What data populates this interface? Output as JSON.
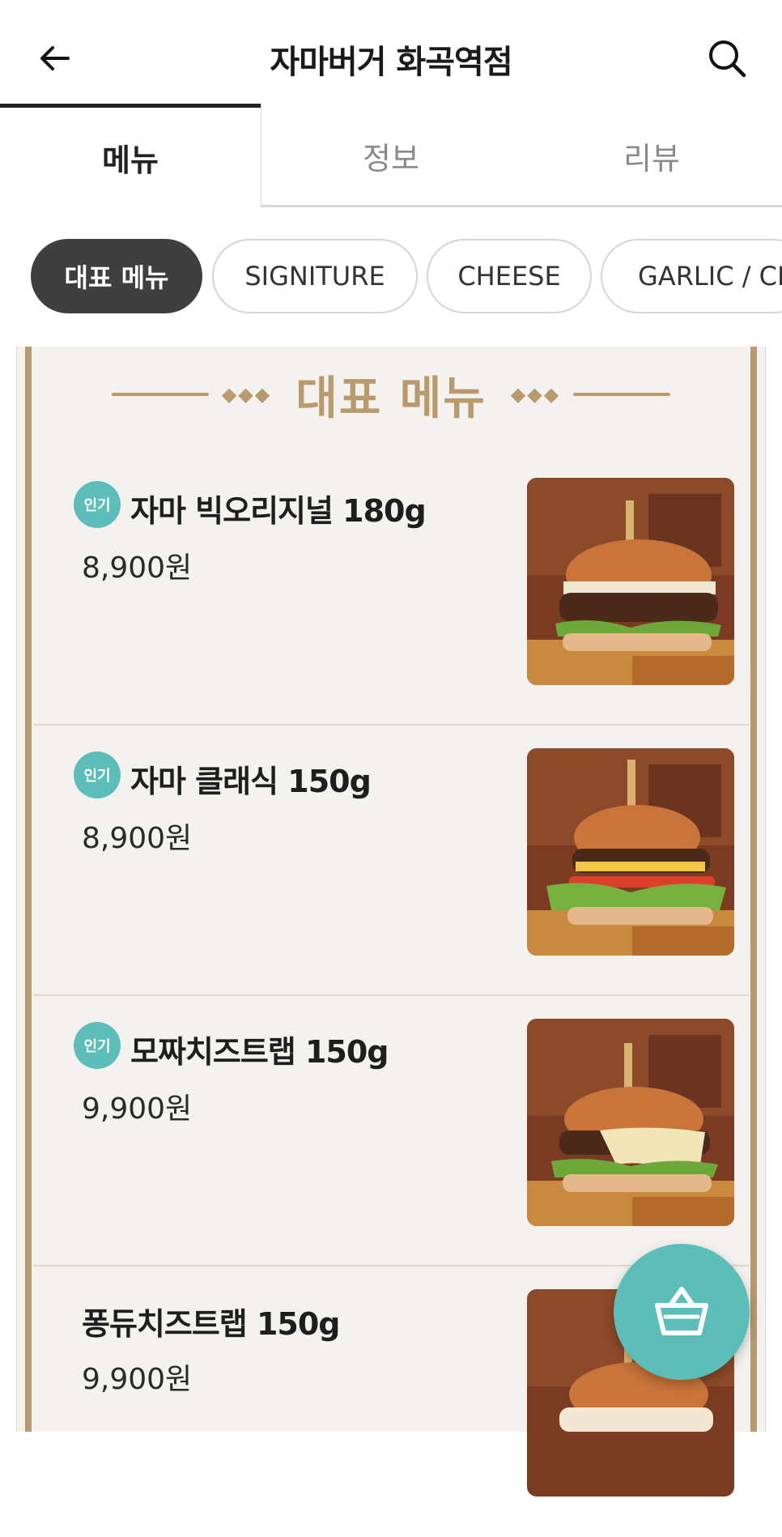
{
  "header": {
    "title": "자마버거 화곡역점",
    "back_icon": "back-arrow-icon",
    "search_icon": "search-icon"
  },
  "tabs": [
    {
      "label": "메뉴",
      "active": true
    },
    {
      "label": "정보",
      "active": false
    },
    {
      "label": "리뷰",
      "active": false
    }
  ],
  "chips": [
    {
      "label": "대표 메뉴",
      "active": true
    },
    {
      "label": "SIGNITURE",
      "active": false
    },
    {
      "label": "CHEESE",
      "active": false
    },
    {
      "label": "GARLIC / CH",
      "active": false
    }
  ],
  "section": {
    "title": "대표 메뉴",
    "ornament": "◆◆◆"
  },
  "items": [
    {
      "badge": "인기",
      "name": "자마 빅오리지널 180g",
      "price": "8,900원"
    },
    {
      "badge": "인기",
      "name": "자마 클래식 150g",
      "price": "8,900원"
    },
    {
      "badge": "인기",
      "name": "모짜치즈트랩 150g",
      "price": "9,900원"
    },
    {
      "badge": "",
      "name": "퐁듀치즈트랩 150g",
      "price": "9,900원"
    }
  ],
  "colors": {
    "accent_teal": "#5dbdb9",
    "gold": "#b99a6f",
    "chip_active": "#3f3f3f"
  },
  "cart": {
    "icon": "shopping-basket-icon"
  }
}
